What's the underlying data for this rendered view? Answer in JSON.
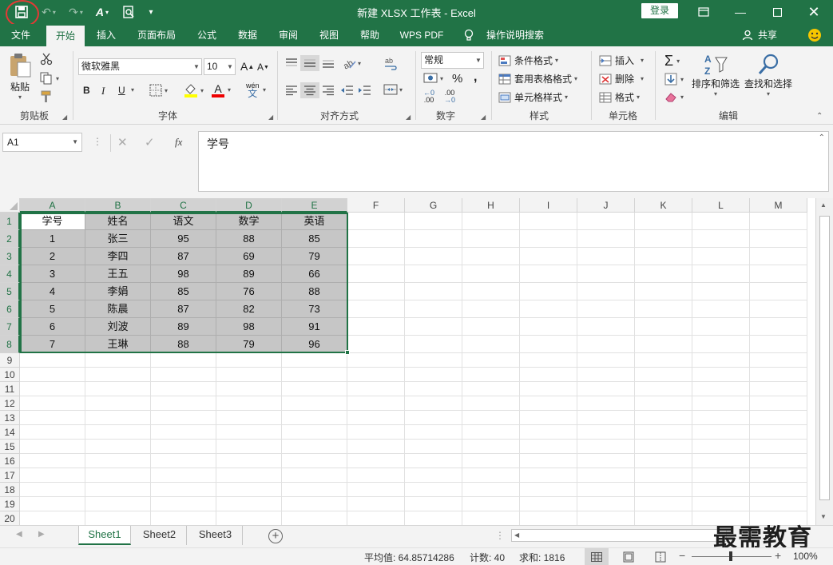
{
  "titlebar": {
    "title": "新建 XLSX 工作表  -  Excel",
    "login_label": "登录"
  },
  "menu_tabs": [
    "文件",
    "开始",
    "插入",
    "页面布局",
    "公式",
    "数据",
    "审阅",
    "视图",
    "帮助",
    "WPS PDF",
    "操作说明搜索",
    "共享"
  ],
  "ribbon": {
    "clipboard": {
      "paste_label": "粘贴",
      "group_label": "剪贴板"
    },
    "font": {
      "font_name": "微软雅黑",
      "font_size": "10",
      "group_label": "字体",
      "bold": "B",
      "italic": "I",
      "underline": "U",
      "grow": "A",
      "shrink": "A",
      "font_color": "A",
      "wen": "wén"
    },
    "alignment": {
      "group_label": "对齐方式"
    },
    "number": {
      "format": "常规",
      "group_label": "数字",
      "percent": "%",
      "comma": ",",
      "dec_inc": ".00",
      "dec_dec": ".00"
    },
    "styles": {
      "conditional": "条件格式",
      "table": "套用表格格式",
      "cell_style": "单元格样式",
      "group_label": "样式"
    },
    "cells": {
      "insert": "插入",
      "delete": "删除",
      "format": "格式",
      "group_label": "单元格"
    },
    "editing": {
      "sort_filter": "排序和筛选",
      "find_select": "查找和选择",
      "group_label": "编辑"
    }
  },
  "formula": {
    "namebox": "A1",
    "content": "学号"
  },
  "columns": [
    "A",
    "B",
    "C",
    "D",
    "E",
    "F",
    "G",
    "H",
    "I",
    "J",
    "K",
    "L",
    "M"
  ],
  "rows": [
    "1",
    "2",
    "3",
    "4",
    "5",
    "6",
    "7",
    "8",
    "9",
    "10",
    "11",
    "12",
    "13",
    "14",
    "15",
    "16",
    "17",
    "18",
    "19",
    "20"
  ],
  "table": [
    [
      "学号",
      "姓名",
      "语文",
      "数学",
      "英语"
    ],
    [
      "1",
      "张三",
      "95",
      "88",
      "85"
    ],
    [
      "2",
      "李四",
      "87",
      "69",
      "79"
    ],
    [
      "3",
      "王五",
      "98",
      "89",
      "66"
    ],
    [
      "4",
      "李娟",
      "85",
      "76",
      "88"
    ],
    [
      "5",
      "陈晨",
      "87",
      "82",
      "73"
    ],
    [
      "6",
      "刘波",
      "89",
      "98",
      "91"
    ],
    [
      "7",
      "王琳",
      "88",
      "79",
      "96"
    ]
  ],
  "sheets": [
    "Sheet1",
    "Sheet2",
    "Sheet3"
  ],
  "status": {
    "average": "平均值: 64.85714286",
    "count": "计数: 40",
    "sum": "求和: 1816",
    "zoom": "100%"
  },
  "watermark": "最需教育",
  "colors": {
    "brand": "#217346",
    "highlight": "#e53935"
  }
}
